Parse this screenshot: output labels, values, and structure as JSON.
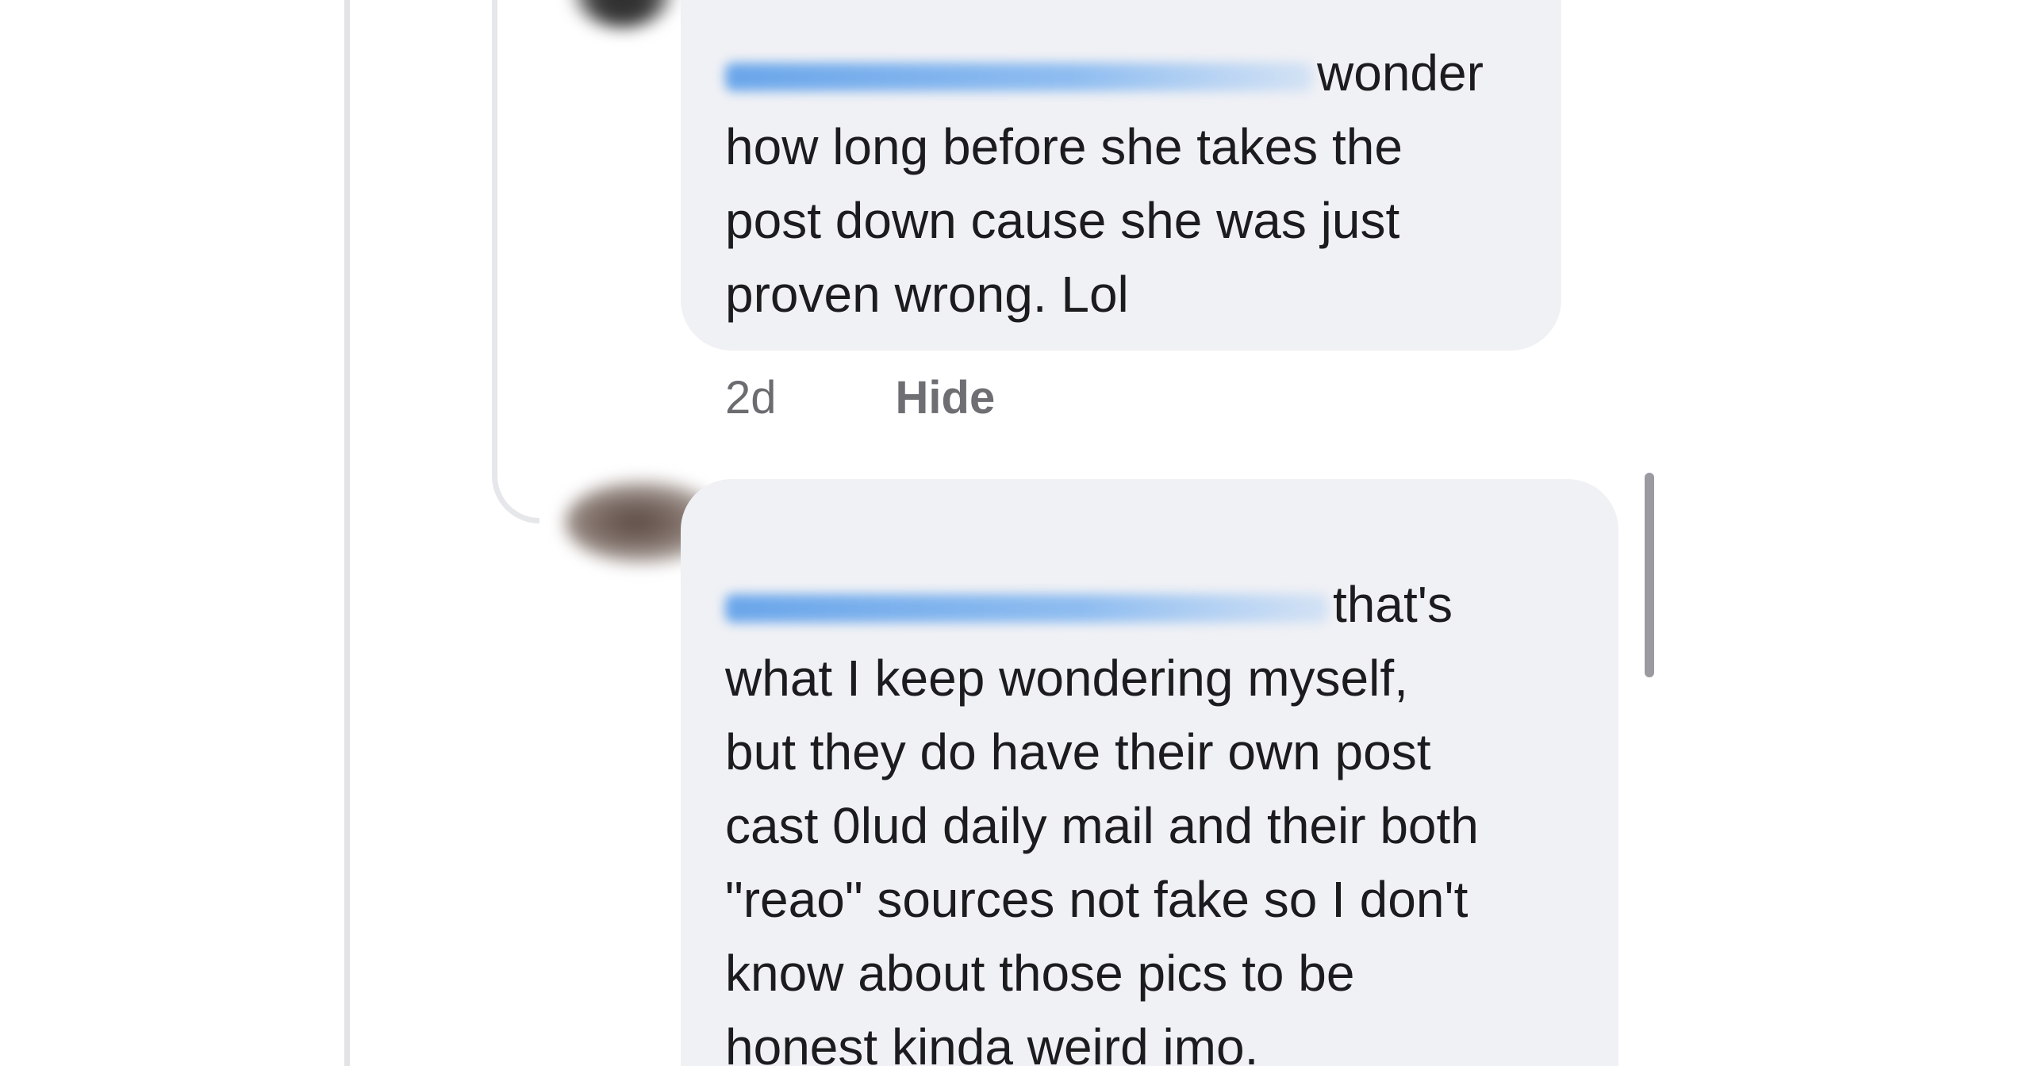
{
  "comments": [
    {
      "mention": "",
      "lines": [
        "wonder",
        "how long before she takes the",
        "post down cause she was just",
        "proven wrong.  Lol"
      ],
      "time": "2d",
      "hide_label": "Hide"
    },
    {
      "mention": "",
      "lines": [
        "that's",
        "what I keep wondering myself,",
        "but they do have their own post",
        "cast 0lud daily mail and their both",
        "\"reao\" sources not fake so I don't",
        "know about those pics to be",
        "honest kinda weird imo."
      ]
    }
  ],
  "colors": {
    "bubble": "#f0f1f5",
    "mention": "#6aa6ea",
    "meta": "#6b6b70",
    "thread_line": "#e4e5e9"
  }
}
